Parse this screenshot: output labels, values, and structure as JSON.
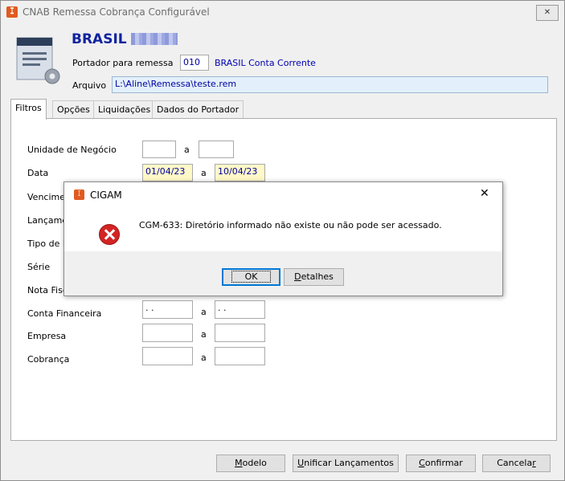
{
  "window": {
    "title": "CNAB Remessa Cobrança Configurável",
    "close_symbol": "✕"
  },
  "header": {
    "brand": "BRASIL",
    "portador_label": "Portador para remessa",
    "portador_code": "010",
    "portador_name": "BRASIL Conta Corrente",
    "arquivo_label": "Arquivo",
    "arquivo_path": "L:\\Aline\\Remessa\\teste.rem"
  },
  "tabs": [
    "Filtros",
    "Opções",
    "Liquidações",
    "Dados do Portador"
  ],
  "filters": {
    "a": "a",
    "rows": [
      {
        "label": "Unidade de Negócio",
        "from": "",
        "to": ""
      },
      {
        "label": "Data",
        "from": "01/04/23",
        "to": "10/04/23"
      },
      {
        "label": "Vencimen",
        "from": "",
        "to": ""
      },
      {
        "label": "Lançame",
        "from": "",
        "to": ""
      },
      {
        "label": "Tipo de P",
        "from": "",
        "to": ""
      },
      {
        "label": "Série",
        "from": "",
        "to": ""
      },
      {
        "label": "Nota Fisc",
        "from": "",
        "to": ""
      },
      {
        "label": "Conta Financeira",
        "from": ". .",
        "to": ". ."
      },
      {
        "label": "Empresa",
        "from": "",
        "to": ""
      },
      {
        "label": "Cobrança",
        "from": "",
        "to": ""
      }
    ]
  },
  "footer": {
    "modelo": {
      "pre": "",
      "key": "M",
      "post": "odelo"
    },
    "unificar": {
      "pre": "",
      "key": "U",
      "post": "nificar Lançamentos"
    },
    "confirmar": {
      "pre": "",
      "key": "C",
      "post": "onfirmar"
    },
    "cancelar": {
      "pre": "Cancela",
      "key": "r",
      "post": ""
    }
  },
  "dialog": {
    "title": "CIGAM",
    "close_symbol": "✕",
    "message": "CGM-633: Diretório informado não existe ou não pode ser acessado.",
    "ok": "OK",
    "detalhes": {
      "pre": "",
      "key": "D",
      "post": "etalhes"
    }
  },
  "colors": {
    "brand": "#10249f",
    "date_bg": "#fff9c8",
    "error": "#d32424",
    "app_icon": "#e05a1f"
  }
}
